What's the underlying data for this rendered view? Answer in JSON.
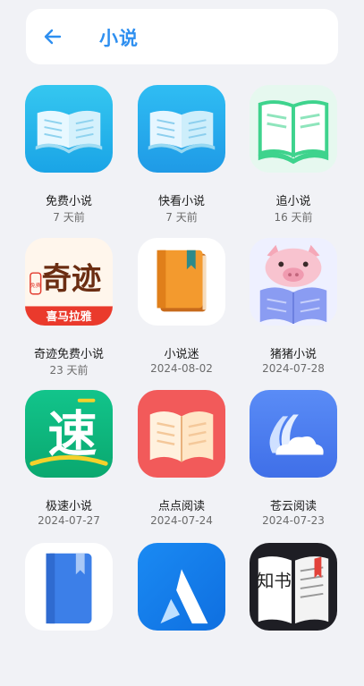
{
  "header": {
    "title": "小说",
    "back_icon": "arrow-left-icon",
    "accent": "#2e8ff0"
  },
  "apps": [
    {
      "name": "免费小说",
      "date": "7 天前",
      "icon": "open-book-cyan-icon"
    },
    {
      "name": "快看小说",
      "date": "7 天前",
      "icon": "open-book-blue-icon"
    },
    {
      "name": "追小说",
      "date": "16 天前",
      "icon": "open-book-green-icon"
    },
    {
      "name": "奇迹免费小说",
      "date": "23 天前",
      "icon": "qiji-logo-icon",
      "logo_text": "奇迹",
      "logo_sub": "喜马拉雅",
      "logo_badge": "免费"
    },
    {
      "name": "小说迷",
      "date": "2024-08-02",
      "icon": "orange-book-icon"
    },
    {
      "name": "猪猪小说",
      "date": "2024-07-28",
      "icon": "pig-reading-icon"
    },
    {
      "name": "极速小说",
      "date": "2024-07-27",
      "icon": "su-logo-icon",
      "logo_text": "速"
    },
    {
      "name": "点点阅读",
      "date": "2024-07-24",
      "icon": "red-open-book-icon"
    },
    {
      "name": "苍云阅读",
      "date": "2024-07-23",
      "icon": "cloud-pages-icon"
    },
    {
      "name": "",
      "date": "",
      "icon": "blue-bookmark-book-icon"
    },
    {
      "name": "",
      "date": "",
      "icon": "blue-mountain-logo-icon"
    },
    {
      "name": "",
      "date": "",
      "icon": "zhishu-book-icon",
      "logo_text": "知书"
    }
  ]
}
